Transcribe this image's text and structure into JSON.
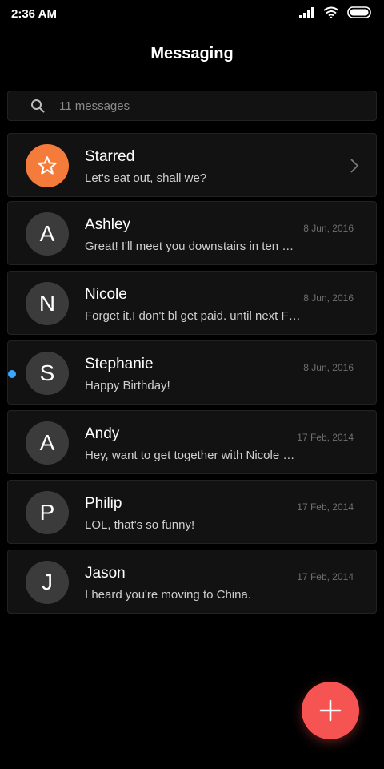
{
  "status_bar": {
    "time": "2:36 AM"
  },
  "header": {
    "title": "Messaging"
  },
  "search": {
    "placeholder": "11 messages"
  },
  "starred": {
    "name": "Starred",
    "snippet": "Let's eat out, shall we?"
  },
  "conversations": [
    {
      "initial": "A",
      "name": "Ashley",
      "date": "8 Jun, 2016",
      "snippet": "Great! I'll meet you downstairs in ten …",
      "unread": false
    },
    {
      "initial": "N",
      "name": "Nicole",
      "date": "8 Jun, 2016",
      "snippet": "Forget it.I don't bl get paid. until next F…",
      "unread": false
    },
    {
      "initial": "S",
      "name": "Stephanie",
      "date": "8 Jun, 2016",
      "snippet": "Happy Birthday!",
      "unread": true
    },
    {
      "initial": "A",
      "name": "Andy",
      "date": "17 Feb, 2014",
      "snippet": "Hey, want to get together with Nicole …",
      "unread": false
    },
    {
      "initial": "P",
      "name": "Philip",
      "date": "17 Feb, 2014",
      "snippet": "LOL, that's so funny!",
      "unread": false
    },
    {
      "initial": "J",
      "name": "Jason",
      "date": "17 Feb, 2014",
      "snippet": "I heard you're moving to China.",
      "unread": false
    }
  ],
  "colors": {
    "accent_fab": "#f65353",
    "starred_avatar": "#f47b3a",
    "unread_dot": "#3aa6ff"
  },
  "icons": [
    "signal-icon",
    "wifi-icon",
    "battery-icon",
    "search-icon",
    "star-icon",
    "chevron-right-icon",
    "plus-icon"
  ]
}
